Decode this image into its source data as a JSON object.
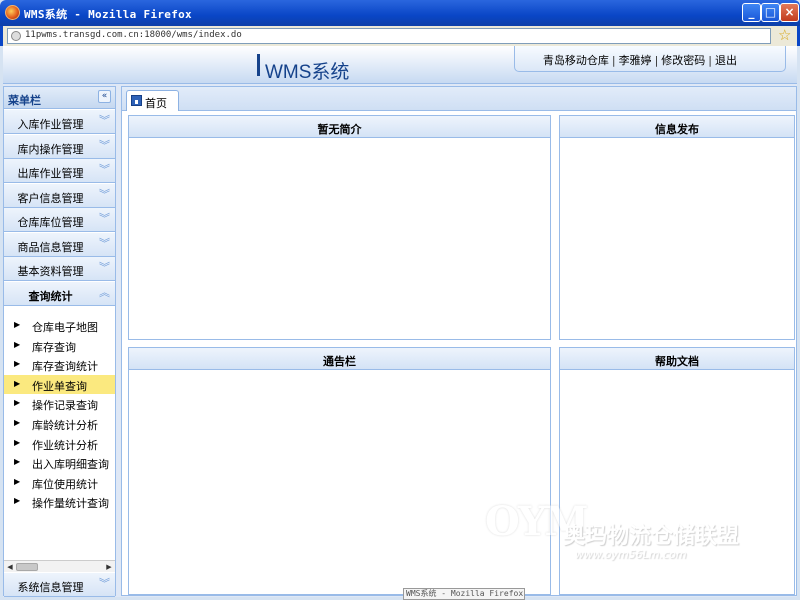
{
  "window": {
    "title": "WMS系统 - Mozilla Firefox",
    "url": "11pwms.transgd.com.cn:18000/wms/index.do"
  },
  "header": {
    "brand": "WMS系统",
    "user_links": [
      "青岛移动仓库",
      "李雅婷",
      "修改密码",
      "退出"
    ]
  },
  "sidebar": {
    "title": "菜单栏",
    "menus": [
      {
        "label": "入库作业管理"
      },
      {
        "label": "库内操作管理"
      },
      {
        "label": "出库作业管理"
      },
      {
        "label": "客户信息管理"
      },
      {
        "label": "仓库库位管理"
      },
      {
        "label": "商品信息管理"
      },
      {
        "label": "基本资料管理"
      },
      {
        "label": "查询统计"
      }
    ],
    "submenu": [
      "仓库电子地图",
      "库存查询",
      "库存查询统计",
      "作业单查询",
      "操作记录查询",
      "库龄统计分析",
      "作业统计分析",
      "出入库明细查询",
      "库位使用统计",
      "操作量统计查询"
    ],
    "selected_submenu": "作业单查询",
    "bottom_menu": {
      "label": "系统信息管理"
    }
  },
  "tabs": [
    {
      "label": "首页"
    }
  ],
  "panels": {
    "intro": "暂无简介",
    "news": "信息发布",
    "notice": "通告栏",
    "help": "帮助文档"
  },
  "tooltip": "WMS系统 - Mozilla Firefox",
  "watermark": {
    "text": "奥玛物流仓储联盟",
    "url": "www.oym56Lm.com"
  }
}
